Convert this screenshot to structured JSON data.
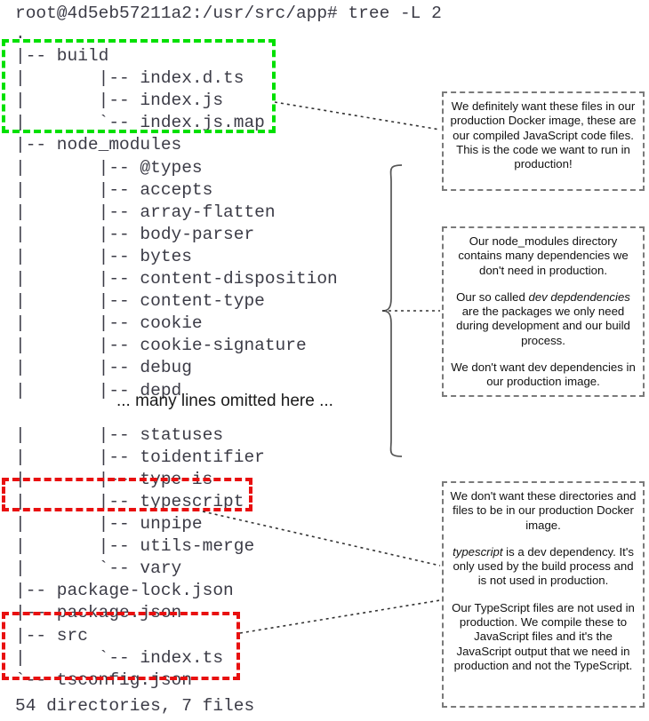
{
  "terminal": {
    "prompt_line": "root@4d5eb57211a2:/usr/src/app# tree -L 2",
    "tree_lines": [
      ".",
      "|-- build",
      "|       |-- index.d.ts",
      "|       |-- index.js",
      "|       `-- index.js.map",
      "|-- node_modules",
      "|       |-- @types",
      "|       |-- accepts",
      "|       |-- array-flatten",
      "|       |-- body-parser",
      "|       |-- bytes",
      "|       |-- content-disposition",
      "|       |-- content-type",
      "|       |-- cookie",
      "|       |-- cookie-signature",
      "|       |-- debug",
      "|       |-- depd",
      "",
      "|       |-- statuses",
      "|       |-- toidentifier",
      "|       |-- type-is",
      "|       |-- typescript",
      "|       |-- unpipe",
      "|       |-- utils-merge",
      "|       `-- vary",
      "|-- package-lock.json",
      "|-- package.json",
      "|-- src",
      "|       `-- index.ts",
      "`-- tsconfig.json"
    ],
    "omitted_note": "... many lines omitted here ...",
    "summary_line": "54 directories, 7 files"
  },
  "highlights": {
    "build_box_color": "#00e000",
    "typescript_box_color": "#e81010",
    "src_box_color": "#e81010"
  },
  "callouts": {
    "build": {
      "paragraphs": [
        "We definitely want these files in our production Docker image, these are our compiled JavaScript code files. This is the code we want to run in production!"
      ]
    },
    "node_modules": {
      "para1": "Our node_modules directory contains many dependencies we don't need in production.",
      "para2_pre": "Our so called ",
      "para2_em": "dev depdendencies",
      "para2_post": " are the packages we only need during development and our build process.",
      "para3": "We don't want dev dependencies in our production image."
    },
    "typescript": {
      "para1": "We don't want these directories and files to be in our production Docker image.",
      "para2_em": "typescript",
      "para2_post": " is a dev dependency. It's only used by the build process and is not used in production.",
      "para3": "Our TypeScript files are not used in production. We compile these to JavaScript files and it's the JavaScript output that we need in production and not the TypeScript."
    }
  }
}
